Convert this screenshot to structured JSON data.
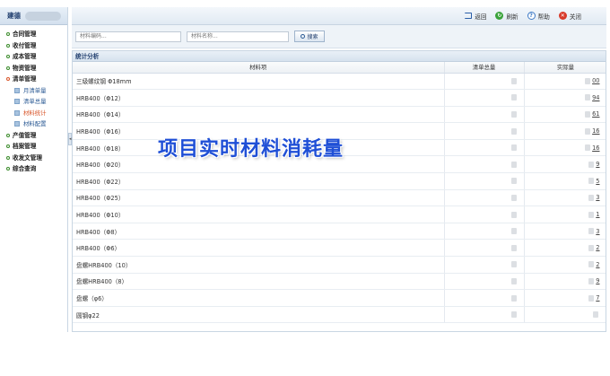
{
  "sidebar": {
    "brand": "建德",
    "items": [
      {
        "label": "合同管理"
      },
      {
        "label": "收付管理"
      },
      {
        "label": "成本管理"
      },
      {
        "label": "物资管理"
      },
      {
        "label": "清单管理"
      }
    ],
    "subitems": [
      {
        "label": "月清单量"
      },
      {
        "label": "清单总量"
      },
      {
        "label": "材料统计"
      },
      {
        "label": "材料配置"
      }
    ],
    "items_after": [
      {
        "label": "产值管理"
      },
      {
        "label": "档案管理"
      },
      {
        "label": "收发文管理"
      },
      {
        "label": "综合查询"
      }
    ]
  },
  "toolbar": {
    "back_label": "返回",
    "refresh_label": "刷新",
    "help_label": "帮助",
    "close_label": "关闭"
  },
  "search": {
    "code_placeholder": "材料编码...",
    "name_placeholder": "材料名称...",
    "button_label": "搜索"
  },
  "panel": {
    "title": "统计分析",
    "columns": [
      "材料项",
      "清单总量",
      "实际量"
    ],
    "rows": [
      {
        "name": "三级螺纹钢 Φ18mm",
        "actual_tail": "00"
      },
      {
        "name": "HRB400（Φ12）",
        "actual_tail": "94"
      },
      {
        "name": "HRB400（Φ14）",
        "actual_tail": "61"
      },
      {
        "name": "HRB400（Φ16）",
        "actual_tail": "16"
      },
      {
        "name": "HRB400（Φ18）",
        "actual_tail": "16"
      },
      {
        "name": "HRB400（Φ20）",
        "actual_tail": "9"
      },
      {
        "name": "HRB400（Φ22）",
        "actual_tail": "5"
      },
      {
        "name": "HRB400（Φ25）",
        "actual_tail": "3"
      },
      {
        "name": "HRB400（Φ10）",
        "actual_tail": "1"
      },
      {
        "name": "HRB400（Φ8）",
        "actual_tail": "3"
      },
      {
        "name": "HRB400（Φ6）",
        "actual_tail": "2"
      },
      {
        "name": "盘螺HRB400（10）",
        "actual_tail": "2"
      },
      {
        "name": "盘螺HRB400（8）",
        "actual_tail": "9"
      },
      {
        "name": "盘螺（φ6）",
        "actual_tail": "7"
      },
      {
        "name": "圆钢φ22",
        "actual_tail": ""
      }
    ]
  },
  "overlay_caption": "项目实时材料消耗量",
  "colors": {
    "accent_blue": "#1f4fd6",
    "active_orange": "#d9562a"
  }
}
